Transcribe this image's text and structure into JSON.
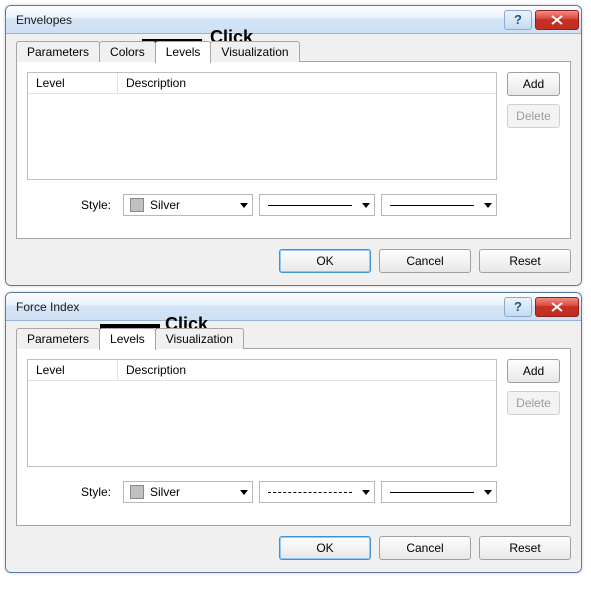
{
  "annotations": {
    "click": "Click"
  },
  "dialogs": [
    {
      "title": "Envelopes",
      "tabs": [
        "Parameters",
        "Colors",
        "Levels",
        "Visualization"
      ],
      "active_tab_index": 2,
      "list": {
        "col_level": "Level",
        "col_desc": "Description"
      },
      "style_label": "Style:",
      "color_name": "Silver",
      "line_variant": "solid",
      "side": {
        "add": "Add",
        "delete": "Delete"
      },
      "footer": {
        "ok": "OK",
        "cancel": "Cancel",
        "reset": "Reset"
      },
      "highlight_tab_index": 2
    },
    {
      "title": "Force Index",
      "tabs": [
        "Parameters",
        "Levels",
        "Visualization"
      ],
      "active_tab_index": 1,
      "list": {
        "col_level": "Level",
        "col_desc": "Description"
      },
      "style_label": "Style:",
      "color_name": "Silver",
      "line_variant": "dashed",
      "side": {
        "add": "Add",
        "delete": "Delete"
      },
      "footer": {
        "ok": "OK",
        "cancel": "Cancel",
        "reset": "Reset"
      },
      "highlight_tab_index": 1
    }
  ]
}
